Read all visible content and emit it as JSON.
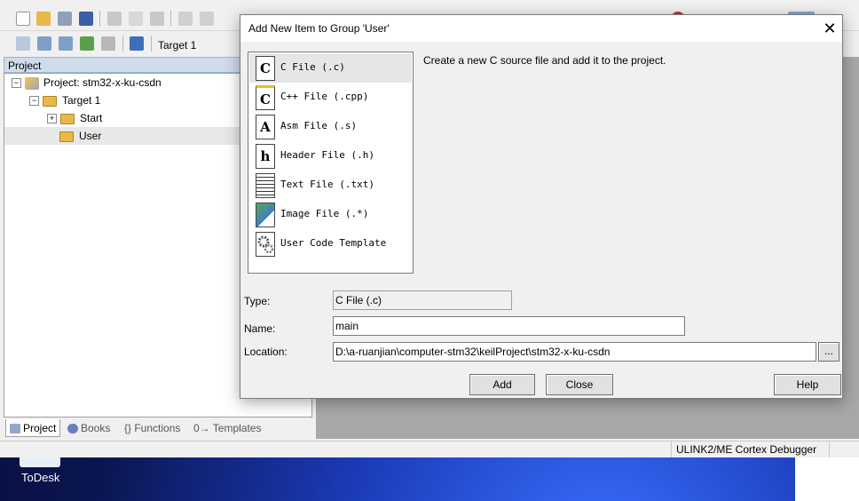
{
  "desktop": {
    "icon_label": "ToDesk"
  },
  "toolbar": {
    "target_select": "Target 1"
  },
  "project_panel": {
    "header": "Project",
    "tree": [
      {
        "label": "Project: stm32-x-ku-csdn",
        "expander": "−"
      },
      {
        "label": "Target 1",
        "expander": "−"
      },
      {
        "label": "Start",
        "expander": "+"
      },
      {
        "label": "User"
      }
    ],
    "tabs": [
      "Project",
      "Books",
      "{} Functions",
      "0→ Templates"
    ]
  },
  "status_bar": {
    "debugger": "ULINK2/ME Cortex Debugger"
  },
  "dialog": {
    "title": "Add New Item to Group 'User'",
    "close_glyph": "✕",
    "items": [
      {
        "icon_text": "C",
        "label": "C File (.c)",
        "icon": "c-file-icon"
      },
      {
        "icon_text": "C",
        "label": "C++ File (.cpp)",
        "icon": "cpp-file-icon"
      },
      {
        "icon_text": "A",
        "label": "Asm File (.s)",
        "icon": "asm-file-icon"
      },
      {
        "icon_text": "h",
        "label": "Header File (.h)",
        "icon": "header-file-icon"
      },
      {
        "icon_text": "",
        "label": "Text File (.txt)",
        "icon": "text-file-icon"
      },
      {
        "icon_text": "",
        "label": "Image File (.*)",
        "icon": "image-file-icon"
      },
      {
        "icon_text": "",
        "label": "User Code Template",
        "icon": "gear-icon"
      }
    ],
    "description": "Create a new C source file and add it to the project.",
    "type_label": "Type:",
    "type_value": "C File (.c)",
    "name_label": "Name:",
    "name_value": "main",
    "location_label": "Location:",
    "location_value": "D:\\a-ruanjian\\computer-stm32\\keilProject\\stm32-x-ku-csdn",
    "browse_label": "...",
    "add_label": "Add",
    "close_label": "Close",
    "help_label": "Help"
  }
}
